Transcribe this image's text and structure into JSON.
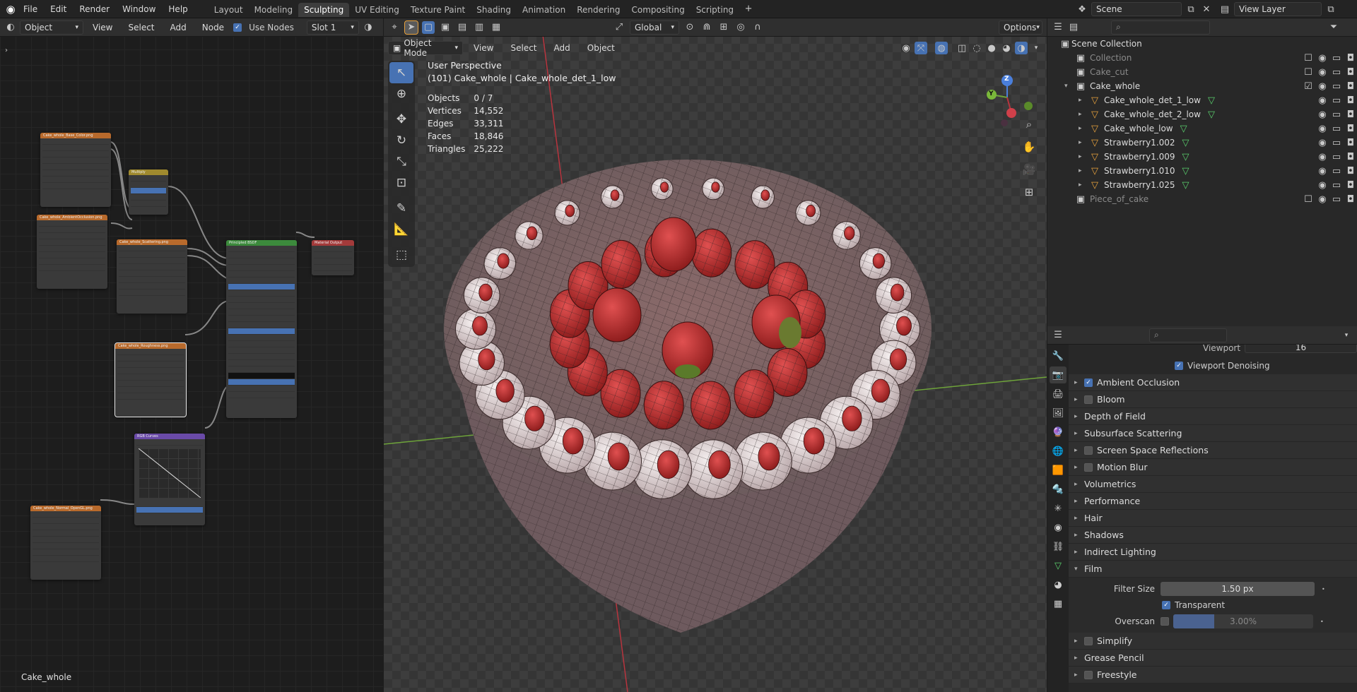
{
  "topbar": {
    "menus": [
      "File",
      "Edit",
      "Render",
      "Window",
      "Help"
    ],
    "workspaces": [
      "Layout",
      "Modeling",
      "Sculpting",
      "UV Editing",
      "Texture Paint",
      "Shading",
      "Animation",
      "Rendering",
      "Compositing",
      "Scripting"
    ],
    "active_workspace": "Sculpting",
    "scene": "Scene",
    "view_layer": "View Layer"
  },
  "node_editor": {
    "object_dropdown": "Object",
    "menus": [
      "View",
      "Select",
      "Add",
      "Node"
    ],
    "use_nodes_label": "Use Nodes",
    "slot": "Slot 1",
    "footer_label": "Cake_whole",
    "nodes": {
      "base_color": "Cake_whole_Base_Color.png",
      "multiply": "Multiply",
      "ao": "Cake_whole_AmbientOcclusion.png",
      "scattering": "Cake_whole_Scattering.png",
      "roughness": "Cake_whole_Roughness.png",
      "bsdf": "Principled BSDF",
      "output": "Material Output",
      "curves": "RGB Curves",
      "normal": "Cake_whole_Normal_OpenGL.png"
    }
  },
  "viewport": {
    "mode": "Object Mode",
    "menus": [
      "View",
      "Select",
      "Add",
      "Object"
    ],
    "transform": "Global",
    "options": "Options",
    "perspective": "User Perspective",
    "active": "(101) Cake_whole | Cake_whole_det_1_low",
    "stats": [
      {
        "label": "Objects",
        "value": "0 / 7"
      },
      {
        "label": "Vertices",
        "value": "14,552"
      },
      {
        "label": "Edges",
        "value": "33,311"
      },
      {
        "label": "Faces",
        "value": "18,846"
      },
      {
        "label": "Triangles",
        "value": "25,222"
      }
    ],
    "gizmo": {
      "z": "Z",
      "y": "Y"
    }
  },
  "outliner": {
    "root": "Scene Collection",
    "items": [
      {
        "name": "Collection",
        "dim": true,
        "indent": 1
      },
      {
        "name": "Cake_cut",
        "dim": true,
        "indent": 1
      },
      {
        "name": "Cake_whole",
        "dim": false,
        "indent": 1
      },
      {
        "name": "Cake_whole_det_1_low",
        "dim": false,
        "indent": 2
      },
      {
        "name": "Cake_whole_det_2_low",
        "dim": false,
        "indent": 2
      },
      {
        "name": "Cake_whole_low",
        "dim": false,
        "indent": 2
      },
      {
        "name": "Strawberry1.002",
        "dim": false,
        "indent": 2
      },
      {
        "name": "Strawberry1.009",
        "dim": false,
        "indent": 2
      },
      {
        "name": "Strawberry1.010",
        "dim": false,
        "indent": 2
      },
      {
        "name": "Strawberry1.025",
        "dim": false,
        "indent": 2
      },
      {
        "name": "Piece_of_cake",
        "dim": true,
        "indent": 1
      }
    ]
  },
  "properties": {
    "viewport_label": "Viewport",
    "viewport_value": "16",
    "viewport_denoising": "Viewport Denoising",
    "panels": [
      "Ambient Occlusion",
      "Bloom",
      "Depth of Field",
      "Subsurface Scattering",
      "Screen Space Reflections",
      "Motion Blur",
      "Volumetrics",
      "Performance",
      "Hair",
      "Shadows",
      "Indirect Lighting",
      "Film"
    ],
    "film": {
      "filter_size_label": "Filter Size",
      "filter_size_value": "1.50 px",
      "transparent_label": "Transparent",
      "overscan_label": "Overscan",
      "overscan_value": "3.00%"
    },
    "panels_after": [
      "Simplify",
      "Grease Pencil",
      "Freestyle"
    ]
  },
  "colors": {
    "accent": "#4772b3",
    "active_orange": "#e8a23d",
    "mesh_green": "#5ad06d",
    "axis_red": "#b8343e",
    "axis_green": "#6ea33a",
    "gizmo_blue": "#4a7fdc"
  }
}
